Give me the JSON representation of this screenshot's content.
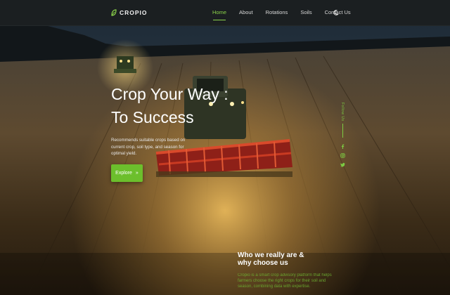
{
  "brand": {
    "name": "CROPIO"
  },
  "nav": {
    "links": [
      "Home",
      "About",
      "Rotations",
      "Soils",
      "Contact Us"
    ],
    "active": "Home",
    "theme_icon": "moon-icon"
  },
  "hero": {
    "title_line1": "Crop Your Way :",
    "title_line2": "To Success",
    "description": "Recommends suitable crops based on current crop, soil type, and season for optimal yield.",
    "cta_label": "Explore",
    "cta_icon": "double-chevron-right-icon"
  },
  "social": {
    "follow_label": "Follow Us",
    "icons": [
      "facebook-icon",
      "instagram-icon",
      "twitter-icon"
    ]
  },
  "about": {
    "title_line1": "Who we really are &",
    "title_line2": "why choose us",
    "text": "Cropio is a smart crop advisory platform that helps farmers choose the right crops for their soil and season, combining data with expertise."
  },
  "colors": {
    "accent": "#6cbf2c",
    "nav_bg": "#1b1f21"
  }
}
